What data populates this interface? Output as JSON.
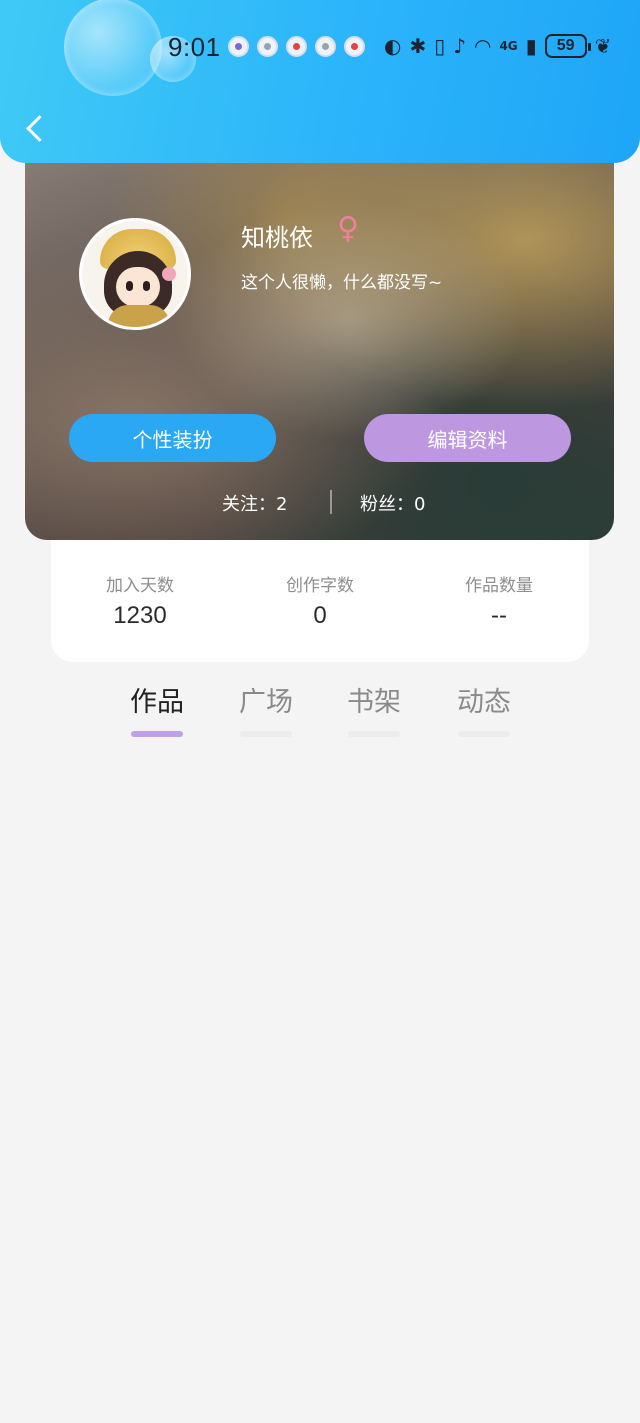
{
  "status_bar": {
    "time": "9:01",
    "network": "4G",
    "battery": "59"
  },
  "profile": {
    "username": "知桃依",
    "gender_symbol": "♀",
    "bio": "这个人很懒，什么都没写~",
    "buttons": {
      "dressup": "个性装扮",
      "edit": "编辑资料"
    },
    "following": "关注：2",
    "fans": "粉丝：0"
  },
  "stats": [
    {
      "label": "加入天数",
      "value": "1230"
    },
    {
      "label": "创作字数",
      "value": "0"
    },
    {
      "label": "作品数量",
      "value": "--"
    }
  ],
  "tabs": [
    {
      "label": "作品",
      "active": true
    },
    {
      "label": "广场",
      "active": false
    },
    {
      "label": "书架",
      "active": false
    },
    {
      "label": "动态",
      "active": false
    }
  ],
  "colors": {
    "header_gradient_start": "#3fcaf6",
    "header_gradient_end": "#1ea6f7",
    "dressup_button": "#2aa8f4",
    "edit_button": "#bd98e0",
    "active_tab_underline": "#c0a0e6",
    "gender_icon": "#ef7f9a",
    "page_background": "#f4f4f4"
  }
}
